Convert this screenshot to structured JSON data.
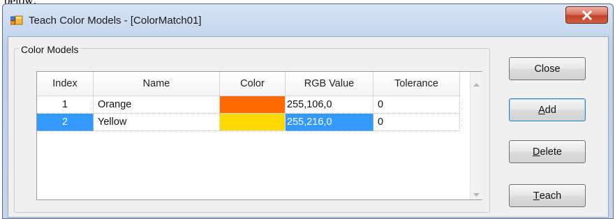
{
  "top_text": "below:",
  "window": {
    "title": "Teach Color Models - [ColorMatch01]",
    "close_glyph": "X"
  },
  "group": {
    "legend": "Color Models"
  },
  "table": {
    "columns": [
      "Index",
      "Name",
      "Color",
      "RGB Value",
      "Tolerance"
    ],
    "rows": [
      {
        "index": "1",
        "name": "Orange",
        "color": "#ff6a00",
        "rgb": "255,106,0",
        "tolerance": "0",
        "selected": false
      },
      {
        "index": "2",
        "name": "Yellow",
        "color": "#ffd800",
        "rgb": "255,216,0",
        "tolerance": "0",
        "selected": true
      }
    ],
    "selection_color": "#3399ff"
  },
  "buttons": {
    "close": {
      "label": "Close"
    },
    "add": {
      "mnemonic": "A",
      "rest": "dd"
    },
    "delete": {
      "mnemonic": "D",
      "rest": "elete"
    },
    "teach": {
      "mnemonic": "T",
      "rest": "each"
    }
  },
  "icons": {
    "app": "window-app-icon",
    "close": "close-icon",
    "scroll_up": "scroll-up-arrow-icon",
    "scroll_down": "scroll-down-arrow-icon"
  }
}
